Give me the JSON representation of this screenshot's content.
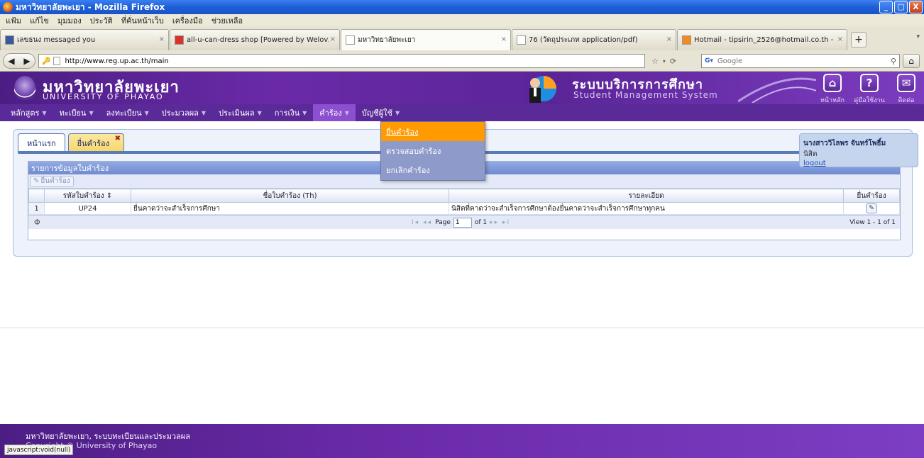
{
  "window": {
    "title": "มหาวิทยาลัยพะเยา - Mozilla Firefox",
    "buttons": {
      "minimize": "_",
      "maximize": "▢",
      "close": "X"
    }
  },
  "browser_menu": [
    "แฟ้ม",
    "แก้ไข",
    "มุมมอง",
    "ประวัติ",
    "ที่คั่นหน้าเว็บ",
    "เครื่องมือ",
    "ช่วยเหลือ"
  ],
  "browser_tabs": [
    {
      "label": "เลขธนง messaged you",
      "icon": "facebook-icon",
      "color": "#3b5998",
      "width": 238
    },
    {
      "label": "all-u-can-dress shop [Powered by Welov...",
      "icon": "mls-icon",
      "color": "#d8342a",
      "width": 240
    },
    {
      "label": "มหาวิทยาลัยพะเยา",
      "icon": "page-icon",
      "color": "#ffffff",
      "width": 240
    },
    {
      "label": "76 (วัตถุประเภท application/pdf)",
      "icon": "page-icon",
      "color": "#ffffff",
      "width": 232
    },
    {
      "label": "Hotmail - tipsirin_2526@hotmail.co.th - ...",
      "icon": "hotmail-icon",
      "color": "#f08a24",
      "width": 240
    }
  ],
  "browser_tab_close": "×",
  "browser_tab_new": "+",
  "browser_tabs_list": "▾",
  "nav": {
    "url": "http://www.reg.up.ac.th/main",
    "search_placeholder": "Google"
  },
  "site": {
    "uni_name_th": "มหาวิทยาลัยพะเยา",
    "uni_name_en": "UNIVERSITY OF PHAYAO",
    "system_name_th": "ระบบบริการการศึกษา",
    "system_name_en": "Student Management System",
    "header_icons": [
      {
        "label": "หน้าหลัก",
        "glyph": "⌂"
      },
      {
        "label": "คู่มือใช้งาน",
        "glyph": "?"
      },
      {
        "label": "ติดต่อ",
        "glyph": "✉"
      }
    ]
  },
  "site_nav": [
    {
      "label": "หลักสูตร",
      "caret": "▼"
    },
    {
      "label": "ทะเบียน",
      "caret": "▼"
    },
    {
      "label": "ลงทะเบียน",
      "caret": "▼"
    },
    {
      "label": "ประมวลผล",
      "caret": "▼"
    },
    {
      "label": "ประเมินผล",
      "caret": "▼"
    },
    {
      "label": "การเงิน",
      "caret": "▼"
    },
    {
      "label": "คำร้อง",
      "caret": "▼",
      "open": true
    },
    {
      "label": "บัญชีผู้ใช้",
      "caret": "▼"
    }
  ],
  "dropdown": [
    {
      "label": "ยื่นคำร้อง",
      "highlighted": true
    },
    {
      "label": "ตรวจสอบคำร้อง",
      "highlighted": false
    },
    {
      "label": "ยกเลิกคำร้อง",
      "highlighted": false
    }
  ],
  "content_tabs": [
    {
      "label": "หน้าแรก",
      "active": false
    },
    {
      "label": "ยื่นคำร้อง",
      "active": true,
      "close": "✖"
    }
  ],
  "grid": {
    "title": "รายการข้อมูลใบคำร้อง",
    "toolbar_button": "ยื่นคำร้อง",
    "columns": [
      "",
      "รหัสใบคำร้อง ⇕",
      "ชื่อใบคำร้อง (Th)",
      "รายละเอียด",
      "ยื่นคำร้อง"
    ],
    "rows": [
      {
        "num": "1",
        "code": "UP24",
        "name": "ยื่นคาดว่าจะสำเร็จการศึกษา",
        "detail": "นิสิตที่คาดว่าจะสำเร็จการศึกษาต้องยื่นคาดว่าจะสำเร็จการศึกษาทุกคน"
      }
    ],
    "pager": {
      "refresh": "Φ",
      "first_prev": "I◂ ◂◂",
      "page_label": "Page",
      "page_value": "1",
      "of_label": "of 1",
      "next_last": "▸▸ ▸I",
      "view_info": "View 1 - 1 of 1"
    }
  },
  "user": {
    "name": "นางสาววิไลพร จันทร์โพธิ์ม",
    "role": "นิสิต",
    "logout": "logout"
  },
  "footer": {
    "line1": "มหาวิทยาลัยพะเยา, ระบบทะเบียนและประมวลผล",
    "line2": "Copyright © University of Phayao"
  },
  "status_text": "javascript:void(null)"
}
